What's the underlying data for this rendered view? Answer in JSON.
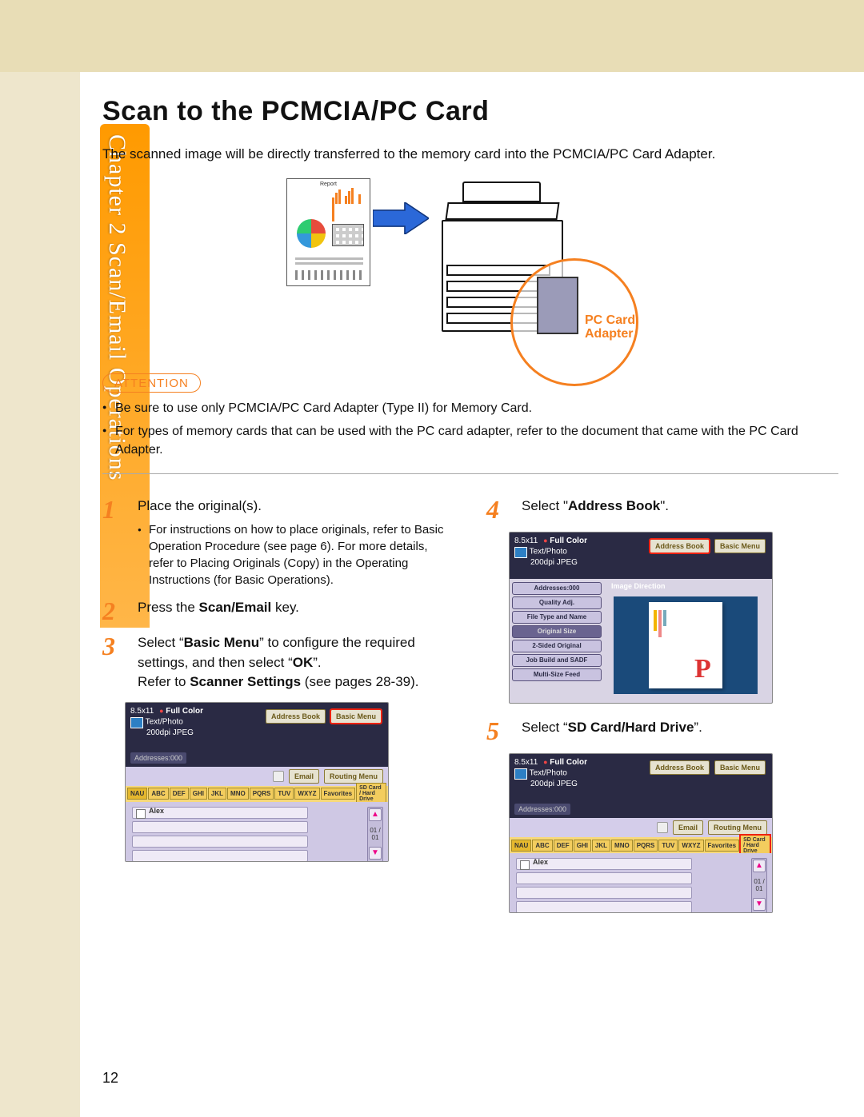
{
  "sidebar": {
    "text": "Chapter 2  Scan/Email Operations"
  },
  "title": "Scan to the PCMCIA/PC Card",
  "intro": "The scanned image will be directly transferred to the memory card into the PCMCIA/PC Card Adapter.",
  "diagram": {
    "doc_title": "Report",
    "callout_line1": "PC Card",
    "callout_line2": "Adapter"
  },
  "attention": {
    "label": "ATTENTION",
    "b1": "Be sure to use only PCMCIA/PC Card Adapter (Type II) for Memory Card.",
    "b2": "For types of memory cards that can be used with the PC card adapter, refer to the document that came with the PC Card Adapter."
  },
  "steps": {
    "s1": {
      "num": "1",
      "text": "Place the original(s).",
      "sub": "For instructions on how to place originals, refer to Basic Operation Procedure (see page 6). For more details, refer to Placing Originals (Copy) in the Operating Instructions (for Basic Operations)."
    },
    "s2": {
      "num": "2",
      "pre": "Press the ",
      "bold": "Scan/Email",
      "post": " key."
    },
    "s3": {
      "num": "3",
      "l1a": "Select “",
      "l1b": "Basic Menu",
      "l1c": "” to configure the required settings, and then select “",
      "l1d": "OK",
      "l1e": "”.",
      "l2a": "Refer to ",
      "l2b": "Scanner Settings",
      "l2c": " (see pages 28-39)."
    },
    "s4": {
      "num": "4",
      "pre": "Select \"",
      "bold": "Address Book",
      "post": "\"."
    },
    "s5": {
      "num": "5",
      "pre": "Select “",
      "bold": "SD Card/Hard Drive",
      "post": "”."
    }
  },
  "ui": {
    "size": "8.5x11",
    "full_color": "Full Color",
    "text_photo": "Text/Photo",
    "dpi": "200dpi JPEG",
    "addr_chip": "Addresses:000",
    "addr_book": "Address Book",
    "basic_menu": "Basic Menu",
    "email": "Email",
    "routing": "Routing Menu",
    "tabs": [
      "NAU",
      "ABC",
      "DEF",
      "GHI",
      "JKL",
      "MNO",
      "PQRS",
      "TUV",
      "WXYZ",
      "Favorites",
      "SD Card / Hard Drive"
    ],
    "alex": "Alex",
    "scroll": "01\n/\n01",
    "img_dir": "Image Direction",
    "side": [
      "Addresses:000",
      "Quality Adj.",
      "File Type and Name",
      "Original Size",
      "2-Sided Original",
      "Job Build and SADF",
      "Multi-Size Feed"
    ]
  },
  "page_number": "12"
}
